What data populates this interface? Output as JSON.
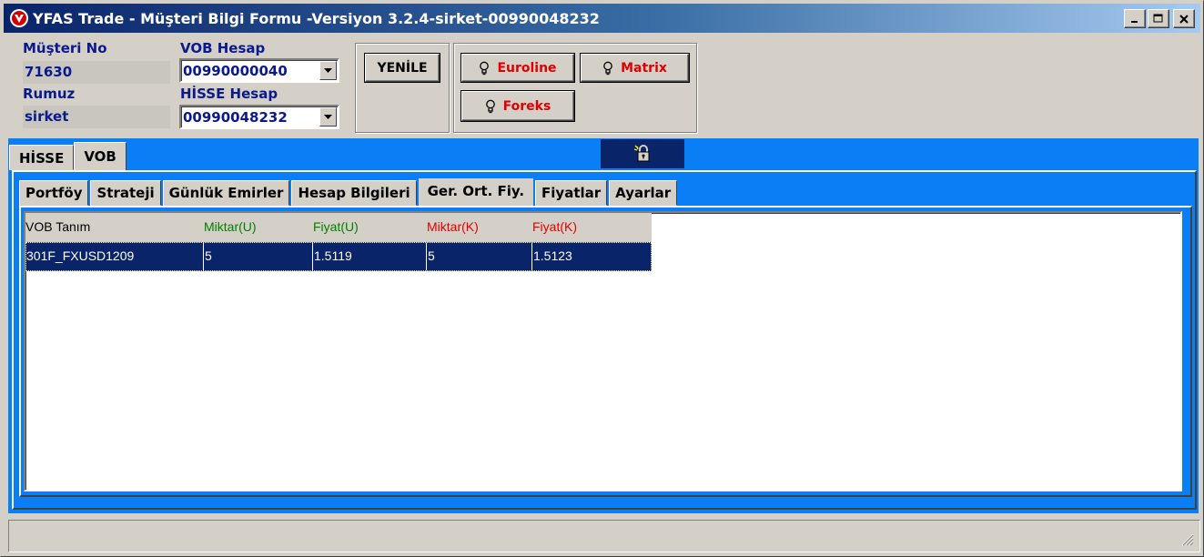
{
  "window": {
    "title": "YFAS Trade - Müşteri Bilgi Formu -Versiyon 3.2.4-sirket-00990048232",
    "icon": "app-logo-icon"
  },
  "header": {
    "musteri_no_label": "Müşteri No",
    "musteri_no_value": "71630",
    "rumuz_label": "Rumuz",
    "rumuz_value": "sirket",
    "vob_hesap_label": "VOB Hesap",
    "vob_hesap_value": "00990000040",
    "hisse_hesap_label": "HİSSE Hesap",
    "hisse_hesap_value": "00990048232",
    "yenile_label": "YENİLE",
    "euroline_label": "Euroline",
    "matrix_label": "Matrix",
    "foreks_label": "Foreks"
  },
  "outer_tabs": [
    {
      "label": "HİSSE",
      "active": false
    },
    {
      "label": "VOB",
      "active": true
    }
  ],
  "inner_tabs": [
    {
      "label": "Portföy",
      "active": false
    },
    {
      "label": "Strateji",
      "active": false
    },
    {
      "label": "Günlük Emirler",
      "active": false
    },
    {
      "label": "Hesap Bilgileri",
      "active": false
    },
    {
      "label": "Ger. Ort. Fiy.",
      "active": true
    },
    {
      "label": "Fiyatlar",
      "active": false
    },
    {
      "label": "Ayarlar",
      "active": false
    }
  ],
  "grid": {
    "columns": [
      {
        "label": "VOB Tanım",
        "color": "#000000"
      },
      {
        "label": "Miktar(U)",
        "color": "#008000"
      },
      {
        "label": "Fiyat(U)",
        "color": "#008000"
      },
      {
        "label": "Miktar(K)",
        "color": "#e00000"
      },
      {
        "label": "Fiyat(K)",
        "color": "#e00000"
      }
    ],
    "rows": [
      [
        "301F_FXUSD1209",
        "5",
        "1.5119",
        "5",
        "1.5123"
      ]
    ]
  },
  "colors": {
    "tab_area": "#0a7ff5",
    "selection": "#0a246a",
    "label_blue": "#0a1a8c",
    "button_red": "#e00000"
  }
}
